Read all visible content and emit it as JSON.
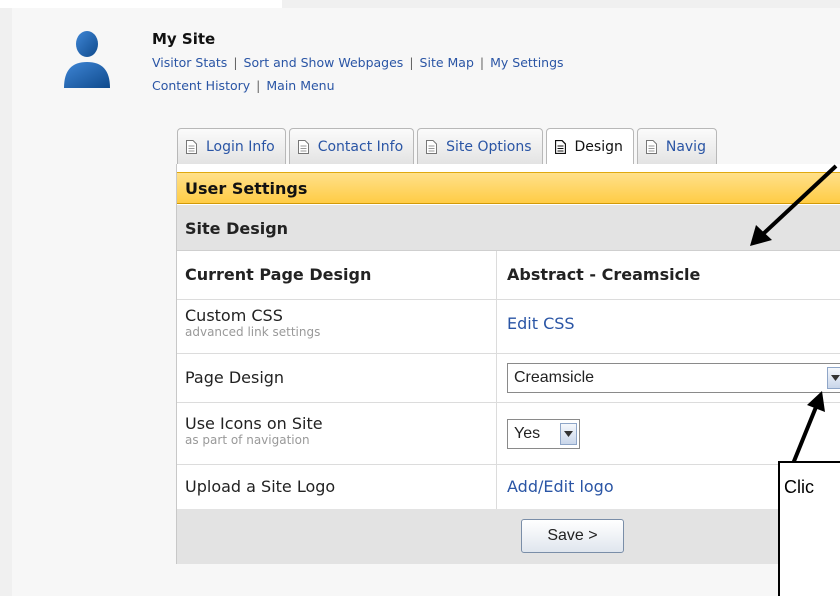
{
  "header": {
    "site_title": "My Site",
    "nav_row1": [
      "Visitor Stats",
      "Sort and Show Webpages",
      "Site Map",
      "My Settings"
    ],
    "nav_row2": [
      "Content History",
      "Main Menu"
    ],
    "separator": "|"
  },
  "tabs": [
    {
      "label": "Login Info",
      "active": false
    },
    {
      "label": "Contact Info",
      "active": false
    },
    {
      "label": "Site Options",
      "active": false
    },
    {
      "label": "Design",
      "active": true
    },
    {
      "label": "Navig",
      "active": false
    }
  ],
  "panel": {
    "title": "User Settings",
    "section": "Site Design",
    "rows": {
      "current_design": {
        "label": "Current Page Design",
        "value": "Abstract - Creamsicle"
      },
      "custom_css": {
        "label": "Custom CSS",
        "hint": "advanced link settings",
        "link": "Edit CSS"
      },
      "page_design": {
        "label": "Page Design",
        "selected": "Creamsicle"
      },
      "use_icons": {
        "label": "Use Icons on Site",
        "hint": "as part of navigation",
        "selected": "Yes"
      },
      "site_logo": {
        "label": "Upload a Site Logo",
        "link": "Add/Edit logo"
      }
    },
    "save_label": "Save >"
  },
  "annotation": {
    "callout_text": "Clic"
  },
  "colors": {
    "link": "#2a55a5",
    "band": "#ffcc45",
    "avatar": "#1c5fa8"
  }
}
